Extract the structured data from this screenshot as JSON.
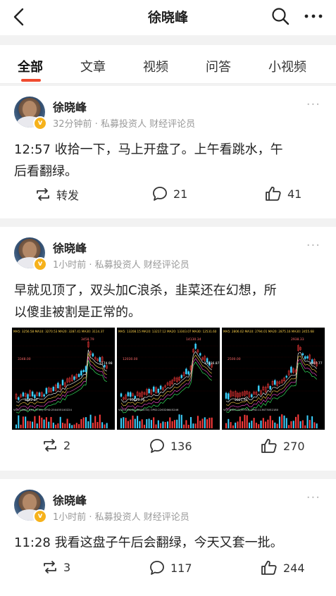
{
  "topbar": {
    "title": "徐晓峰"
  },
  "tabs": [
    {
      "label": "全部"
    },
    {
      "label": "文章"
    },
    {
      "label": "视频"
    },
    {
      "label": "问答"
    },
    {
      "label": "小视频"
    }
  ],
  "posts": [
    {
      "author": "徐晓峰",
      "meta": "32分钟前 · 私募投资人 财经评论员",
      "text_line1": "12:57 收拾一下，马上开盘了。上午看跳水，午",
      "text_line2": "后看翻绿。",
      "repost_label": "转发",
      "comments": "21",
      "likes": "41"
    },
    {
      "author": "徐晓峰",
      "meta": "1小时前 · 私募投资人 财经评论员",
      "text_line1": "早就见顶了，双头加C浪杀，韭菜还在幻想，所",
      "text_line2": "以傻韭被割是正常的。",
      "reposts": "2",
      "comments": "136",
      "likes": "270",
      "images": [
        {
          "top_label": "MA5: 3256.58  MA10: 3270.53  MA20: 3287.41  MA30: 3114.37",
          "peak": "3458.79",
          "right_a": "3174.98",
          "mid": "3348.00",
          "low": "2862.47",
          "vol": "VOL:189017(9479.55)  OPID:250455100224"
        },
        {
          "top_label": "MA5: 13208.15  MA10: 13217.12  MA20: 13303.07  MA30: 12531.60",
          "peak": "14130.34",
          "right_a": "13236.87",
          "mid": "12030.00",
          "low": "10520.70",
          "vol": "VOL:245003238(50:50)  OPID:226326645246"
        },
        {
          "top_label": "MA5: 2806.02  MA10: 2794.01  MA20: 2875.16  MA30: 2455.68",
          "peak": "2938.33",
          "right_a": "2807.77",
          "mid": "2500.00",
          "low": "2021.96",
          "vol": "VOL:663715(50:50)  OPID:113673052180"
        }
      ]
    },
    {
      "author": "徐晓峰",
      "meta": "1小时前 · 私募投资人 财经评论员",
      "text_line1": "11:28 我看这盘子午后会翻绿，今天又套一批。",
      "reposts": "3",
      "comments": "117",
      "likes": "244"
    }
  ],
  "icons": [
    "back-arrow-icon",
    "search-icon",
    "more-icon",
    "repost-icon",
    "comment-icon",
    "like-icon"
  ],
  "colors": {
    "accent": "#f04b2f",
    "badge": "#f6b21b",
    "chart_bg": "#000000",
    "candle_up": "#ff3b3b",
    "candle_down": "#3bd1ff"
  }
}
